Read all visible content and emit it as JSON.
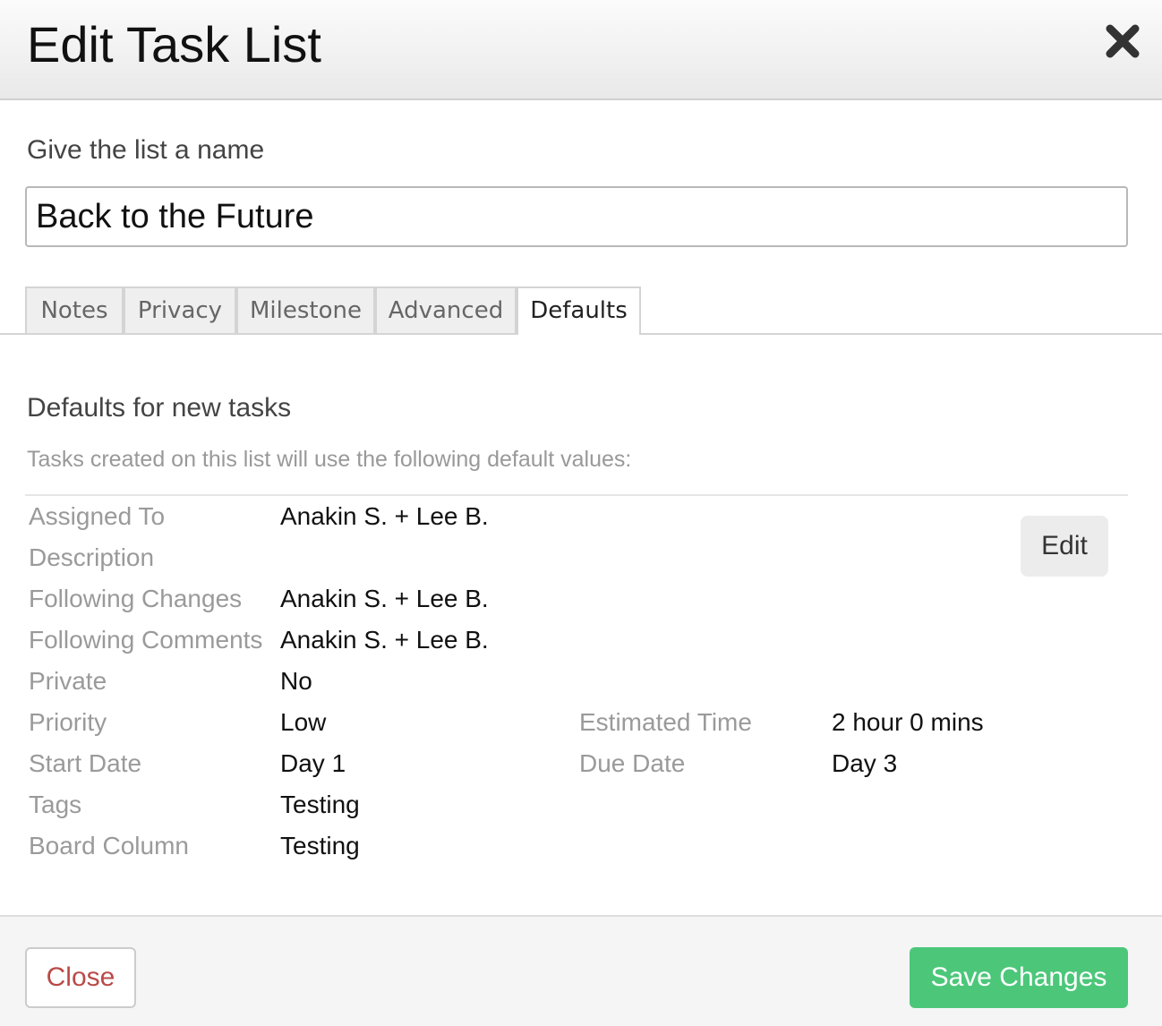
{
  "header": {
    "title": "Edit Task List",
    "close_icon": "close-icon"
  },
  "name_section": {
    "label": "Give the list a name",
    "value": "Back to the Future"
  },
  "tabs": [
    {
      "label": "Notes",
      "active": false
    },
    {
      "label": "Privacy",
      "active": false
    },
    {
      "label": "Milestone",
      "active": false
    },
    {
      "label": "Advanced",
      "active": false
    },
    {
      "label": "Defaults",
      "active": true
    }
  ],
  "defaults": {
    "title": "Defaults for new tasks",
    "description": "Tasks created on this list will use the following default values:",
    "edit_label": "Edit",
    "fields": {
      "assigned_to": {
        "label": "Assigned To",
        "value": "Anakin S. + Lee B."
      },
      "description": {
        "label": "Description",
        "value": ""
      },
      "following_changes": {
        "label": "Following Changes",
        "value": "Anakin S. + Lee B."
      },
      "following_comments": {
        "label": "Following Comments",
        "value": "Anakin S. + Lee B."
      },
      "private": {
        "label": "Private",
        "value": "No"
      },
      "priority": {
        "label": "Priority",
        "value": "Low"
      },
      "estimated_time": {
        "label": "Estimated Time",
        "value": "2 hour 0 mins"
      },
      "start_date": {
        "label": "Start Date",
        "value": "Day 1"
      },
      "due_date": {
        "label": "Due Date",
        "value": "Day 3"
      },
      "tags": {
        "label": "Tags",
        "value": "Testing"
      },
      "board_column": {
        "label": "Board Column",
        "value": "Testing"
      }
    }
  },
  "footer": {
    "close_label": "Close",
    "save_label": "Save Changes"
  },
  "colors": {
    "save_button": "#4cc77a",
    "close_text": "#b94a48"
  }
}
